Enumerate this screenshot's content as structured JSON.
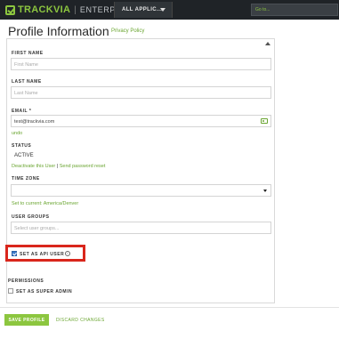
{
  "header": {
    "brand": "TRACKVIA",
    "separator": "|",
    "edition": "ENTERPRISE",
    "app_select_label": "ALL APPLIC...",
    "goto_placeholder": "Go to..."
  },
  "page": {
    "title": "Profile Information",
    "privacy_link": "Privacy Policy"
  },
  "form": {
    "first_name": {
      "label": "FIRST NAME",
      "placeholder": "First Name",
      "value": ""
    },
    "last_name": {
      "label": "LAST NAME",
      "placeholder": "Last Name",
      "value": ""
    },
    "email": {
      "label": "EMAIL *",
      "value": "test@trackvia.com",
      "undo_link": "undo"
    },
    "status": {
      "label": "STATUS",
      "value": "ACTIVE",
      "deactivate_link": "Deactivate this User",
      "divider": "|",
      "reset_link": "Send password reset"
    },
    "time_zone": {
      "label": "TIME ZONE",
      "value": "",
      "set_current_link": "Set to current: America/Denver"
    },
    "user_groups": {
      "label": "USER GROUPS",
      "placeholder": "Select user groups..."
    },
    "api_user": {
      "label": "SET AS API USER",
      "checked": true,
      "info_glyph": "i"
    }
  },
  "permissions": {
    "label": "PERMISSIONS",
    "super_admin": {
      "label": "SET AS SUPER ADMIN",
      "checked": false
    }
  },
  "actions": {
    "save_label": "SAVE PROFILE",
    "discard_label": "DISCARD CHANGES"
  },
  "colors": {
    "brand_green": "#8cc63f",
    "link_green": "#6aa531",
    "highlight_red": "#d9261c",
    "topbar": "#1f2327"
  }
}
